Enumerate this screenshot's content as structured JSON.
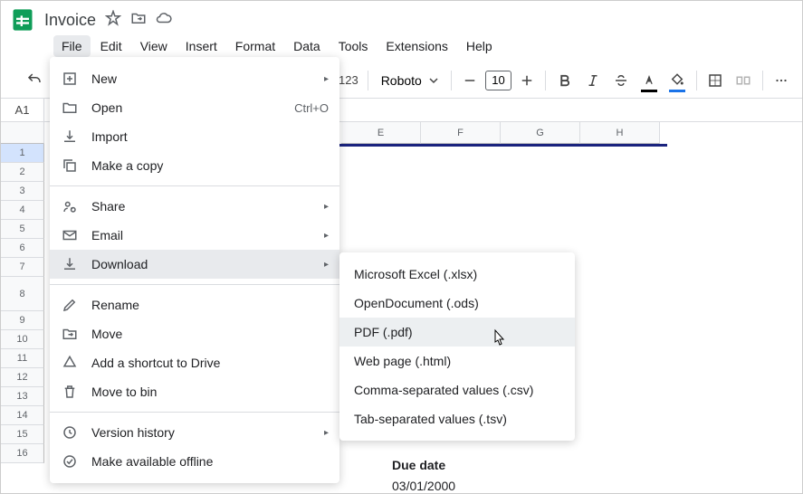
{
  "document": {
    "title": "Invoice"
  },
  "menubar": {
    "file": "File",
    "edit": "Edit",
    "view": "View",
    "insert": "Insert",
    "format": "Format",
    "data": "Data",
    "tools": "Tools",
    "extensions": "Extensions",
    "help": "Help"
  },
  "toolbar": {
    "num_format_suffix": "123",
    "font": "Roboto",
    "font_size": "10"
  },
  "formula_bar": {
    "cell_ref": "A1"
  },
  "columns": [
    "E",
    "F",
    "G",
    "H"
  ],
  "rows": [
    "1",
    "2",
    "3",
    "4",
    "5",
    "6",
    "7",
    "8",
    "9",
    "10",
    "11",
    "12",
    "13",
    "14",
    "15",
    "16"
  ],
  "file_menu": {
    "new": "New",
    "open": "Open",
    "open_shortcut": "Ctrl+O",
    "import": "Import",
    "make_copy": "Make a copy",
    "share": "Share",
    "email": "Email",
    "download": "Download",
    "rename": "Rename",
    "move": "Move",
    "add_shortcut": "Add a shortcut to Drive",
    "move_bin": "Move to bin",
    "version_history": "Version history",
    "offline": "Make available offline"
  },
  "download_submenu": {
    "xlsx": "Microsoft Excel (.xlsx)",
    "ods": "OpenDocument (.ods)",
    "pdf": "PDF (.pdf)",
    "html": "Web page (.html)",
    "csv": "Comma-separated values (.csv)",
    "tsv": "Tab-separated values (.tsv)"
  },
  "sheet_content": {
    "due_date_label": "Due date",
    "due_date_value": "03/01/2000"
  }
}
